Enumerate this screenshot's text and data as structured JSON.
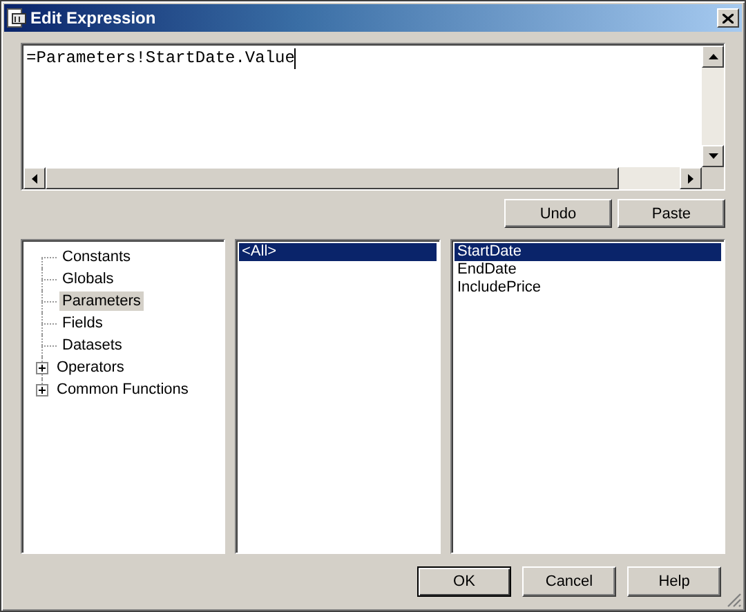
{
  "window": {
    "title": "Edit Expression"
  },
  "expression": {
    "value": "=Parameters!StartDate.Value"
  },
  "edit_buttons": [
    "Undo",
    "Paste"
  ],
  "category_tree": [
    {
      "label": "Constants",
      "selected": false,
      "expandable": false
    },
    {
      "label": "Globals",
      "selected": false,
      "expandable": false
    },
    {
      "label": "Parameters",
      "selected": true,
      "expandable": false
    },
    {
      "label": "Fields",
      "selected": false,
      "expandable": false
    },
    {
      "label": "Datasets",
      "selected": false,
      "expandable": false
    },
    {
      "label": "Operators",
      "selected": false,
      "expandable": true
    },
    {
      "label": "Common Functions",
      "selected": false,
      "expandable": true
    }
  ],
  "category_items": [
    {
      "label": "<All>",
      "selected": true
    }
  ],
  "item_list": [
    {
      "label": "StartDate",
      "selected": true
    },
    {
      "label": "EndDate",
      "selected": false
    },
    {
      "label": "IncludePrice",
      "selected": false
    }
  ],
  "buttons": [
    "OK",
    "Cancel",
    "Help"
  ]
}
